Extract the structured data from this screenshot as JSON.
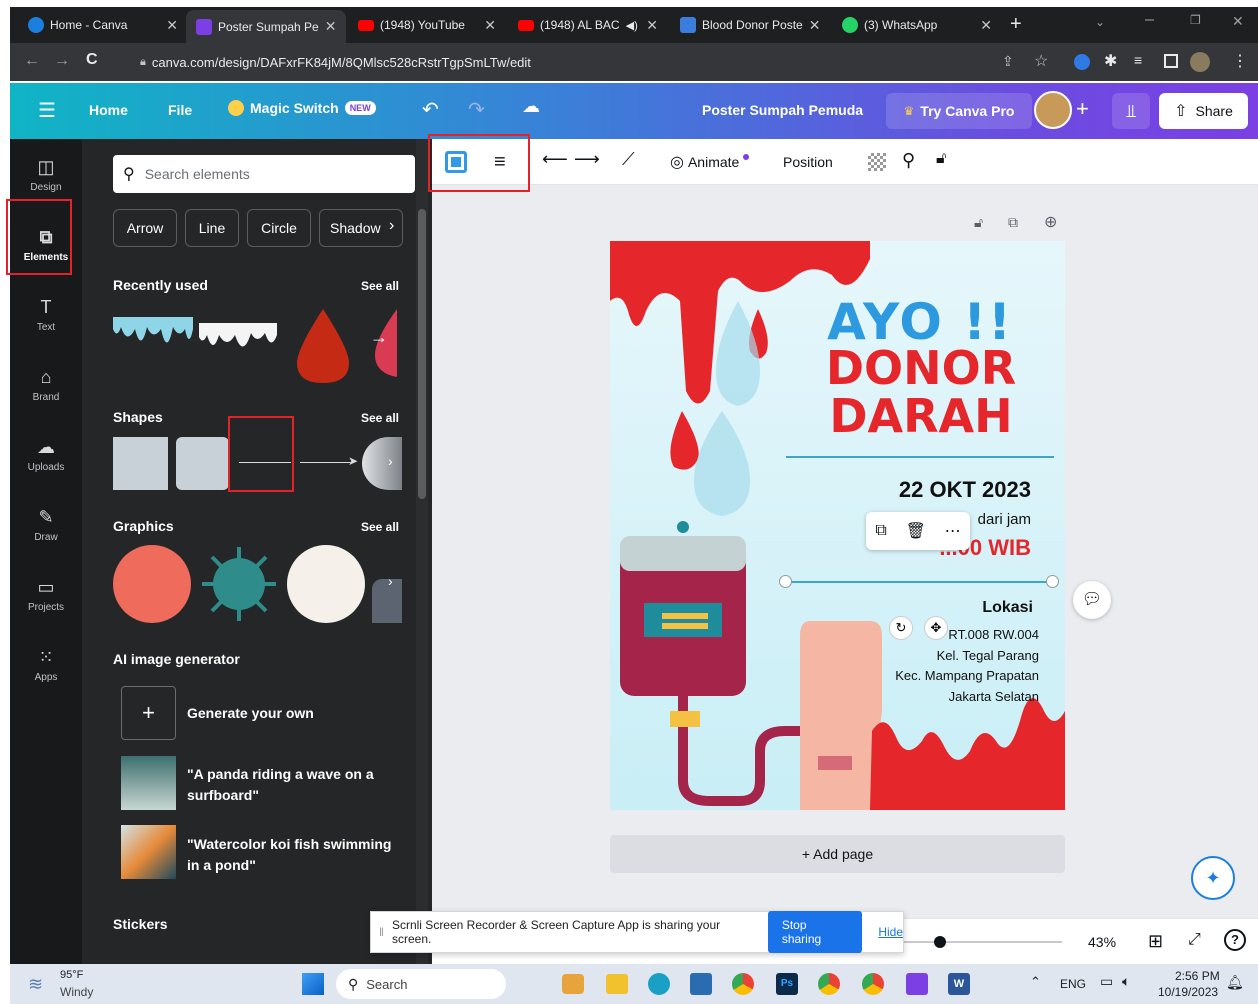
{
  "browser": {
    "tabs": [
      {
        "title": "Home - Canva",
        "color": "#1b7fe0"
      },
      {
        "title": "Poster Sumpah Pe",
        "color": "#7b3fe4"
      },
      {
        "title": "(1948) YouTube",
        "color": "#ff0000"
      },
      {
        "title": "(1948) AL BAC",
        "color": "#ff0000"
      },
      {
        "title": "Blood Donor Poste",
        "color": "#3b7ddd"
      },
      {
        "title": "(3) WhatsApp",
        "color": "#25d366"
      }
    ],
    "url": "canva.com/design/DAFxrFK84jM/8QMlsc528cRstrTgpSmLTw/edit"
  },
  "header": {
    "home": "Home",
    "file": "File",
    "magic_switch": "Magic Switch",
    "new_badge": "NEW",
    "doc_title": "Poster Sumpah Pemuda",
    "try_pro": "Try Canva Pro",
    "share": "Share"
  },
  "rail": [
    {
      "label": "Design",
      "icon": "design-icon"
    },
    {
      "label": "Elements",
      "icon": "elements-icon"
    },
    {
      "label": "Text",
      "icon": "text-icon"
    },
    {
      "label": "Brand",
      "icon": "brand-icon"
    },
    {
      "label": "Uploads",
      "icon": "uploads-icon"
    },
    {
      "label": "Draw",
      "icon": "draw-icon"
    },
    {
      "label": "Projects",
      "icon": "projects-icon"
    },
    {
      "label": "Apps",
      "icon": "apps-icon"
    }
  ],
  "panel": {
    "search_placeholder": "Search elements",
    "chips": [
      "Arrow",
      "Line",
      "Circle",
      "Shadow"
    ],
    "recently_used": "Recently used",
    "shapes": "Shapes",
    "graphics": "Graphics",
    "see_all": "See all",
    "ai_title": "AI image generator",
    "generate": "Generate your own",
    "prompt1": "\"A panda riding a wave on a surfboard\"",
    "prompt2": "\"Watercolor koi fish swimming in a pond\"",
    "stickers": "Stickers"
  },
  "toolbar": {
    "animate": "Animate",
    "position": "Position"
  },
  "poster": {
    "line1": "AYO !!",
    "line2": "DONOR",
    "line3": "DARAH",
    "date": "22 OKT 2023",
    "from": "dari jam",
    "time": "...00 WIB",
    "loc_title": "Lokasi",
    "addr1": "RT.008 RW.004",
    "addr2": "Kel. Tegal Parang",
    "addr3": "Kec. Mampang Prapatan",
    "addr4": "Jakarta Selatan"
  },
  "editor": {
    "add_page": "+ Add page",
    "zoom": "43%",
    "sharing_text": "Scrnli Screen Recorder & Screen Capture App is sharing your screen.",
    "stop_sharing": "Stop sharing",
    "hide": "Hide"
  },
  "taskbar": {
    "temp": "95°F",
    "weather": "Windy",
    "search": "Search",
    "lang": "ENG",
    "time": "2:56 PM",
    "date": "10/19/2023"
  }
}
